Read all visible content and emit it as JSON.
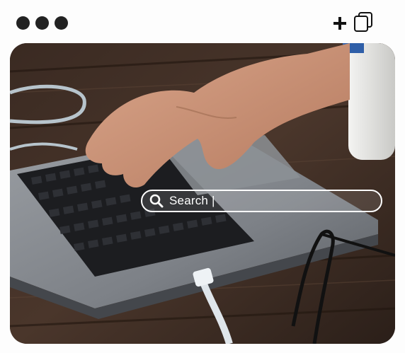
{
  "toolbar": {
    "window_controls": [
      "dot",
      "dot",
      "dot"
    ],
    "new_tab_icon": "plus-icon",
    "duplicate_icon": "copy-icon"
  },
  "hero": {
    "image_description_icon": "photo",
    "search": {
      "placeholder": "Search |",
      "icon": "search-icon"
    }
  },
  "colors": {
    "dot": "#222222",
    "search_border": "#ffffff",
    "search_text": "#ffffff"
  }
}
